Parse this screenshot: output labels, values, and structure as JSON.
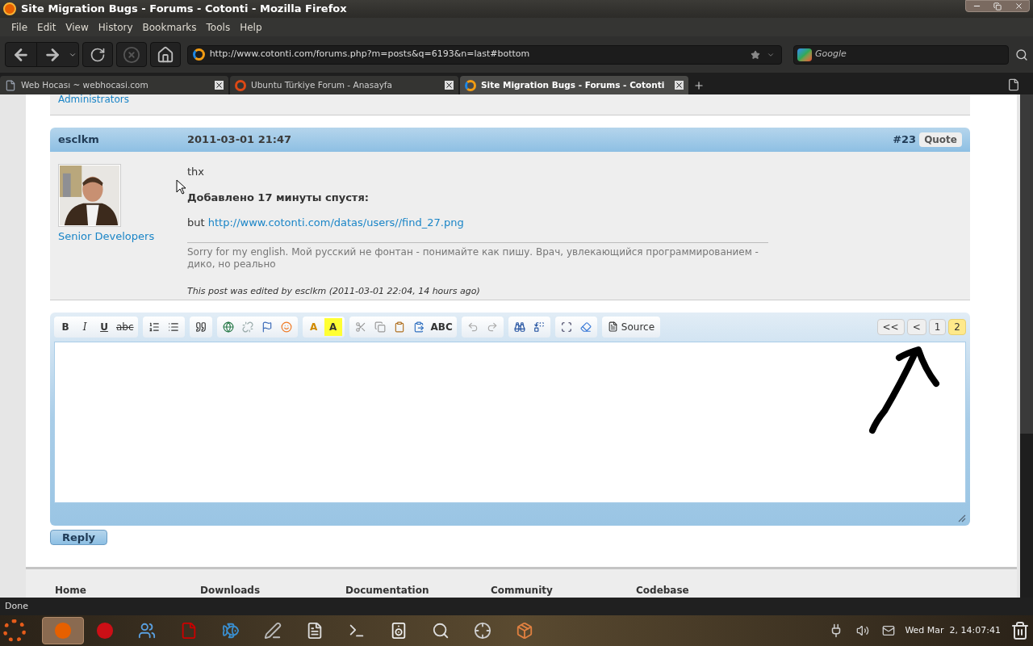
{
  "window": {
    "title": "Site Migration Bugs - Forums - Cotonti - Mozilla Firefox"
  },
  "menu": [
    "File",
    "Edit",
    "View",
    "History",
    "Bookmarks",
    "Tools",
    "Help"
  ],
  "address_bar": {
    "value": "http://www.cotonti.com/forums.php?m=posts&q=6193&n=last#bottom"
  },
  "search_bar": {
    "placeholder": "Google"
  },
  "tabs": [
    {
      "label": "Web Hocası ~ webhocasi.com",
      "kind": "page",
      "selected": false
    },
    {
      "label": "Ubuntu Türkiye Forum - Anasayfa",
      "kind": "ubuntu",
      "selected": false
    },
    {
      "label": "Site Migration Bugs - Forums - Cotonti",
      "kind": "cotonti",
      "selected": true
    }
  ],
  "previous_post": {
    "group": "Administrators"
  },
  "post": {
    "author": "esclkm",
    "date": "2011-03-01 21:47",
    "number": "#23",
    "quote": "Quote",
    "group": "Senior Developers",
    "lines": [
      {
        "kind": "plain",
        "text": "thx"
      },
      {
        "kind": "bold",
        "text": "Добавлено 17 минуты спустя:"
      },
      {
        "kind": "link",
        "text": "but ",
        "link": "http://www.cotonti.com/datas/users//find_27.png"
      }
    ],
    "signature": "Sorry for my english. Мой русский не фонтан - понимайте как пишу. Врач, увлекающийся программированием - дико, но реально",
    "edited": "This post was edited by esclkm (2011-03-01 22:04, 14 hours ago)"
  },
  "editor": {
    "toolbar": [
      [
        {
          "kind": "bold",
          "label": "B"
        },
        {
          "kind": "italic",
          "label": "I"
        },
        {
          "kind": "underline",
          "label": "U"
        },
        {
          "kind": "strike",
          "label": "abc"
        }
      ],
      [
        {
          "kind": "numbered"
        },
        {
          "kind": "bulleted"
        }
      ],
      [
        {
          "kind": "quote"
        }
      ],
      [
        {
          "kind": "link"
        },
        {
          "kind": "unlink"
        },
        {
          "kind": "anchor"
        },
        {
          "kind": "smiley"
        }
      ],
      [
        {
          "kind": "textcolor",
          "label": "A"
        },
        {
          "kind": "bgcolor",
          "label": "A"
        }
      ],
      [
        {
          "kind": "cut"
        },
        {
          "kind": "copy"
        },
        {
          "kind": "paste"
        },
        {
          "kind": "pasteword"
        },
        {
          "kind": "spell",
          "label": "ABC"
        }
      ],
      [
        {
          "kind": "undo"
        },
        {
          "kind": "redo"
        }
      ],
      [
        {
          "kind": "find"
        },
        {
          "kind": "replace"
        }
      ],
      [
        {
          "kind": "selectall"
        },
        {
          "kind": "eraser"
        }
      ],
      [
        {
          "kind": "source",
          "label": "Source"
        }
      ]
    ],
    "pages": [
      {
        "label": "<<",
        "selected": false
      },
      {
        "label": "<",
        "selected": false
      },
      {
        "label": "1",
        "selected": false
      },
      {
        "label": "2",
        "selected": true
      }
    ]
  },
  "reply_button": "Reply",
  "footer": [
    "Home",
    "Downloads",
    "Documentation",
    "Community",
    "Codebase"
  ],
  "status_bar": "Done",
  "taskbar": {
    "launchers": [
      {
        "kind": "firefox",
        "selected": true
      },
      {
        "kind": "opera",
        "selected": false
      },
      {
        "kind": "chat",
        "selected": false
      },
      {
        "kind": "filezilla",
        "selected": false
      },
      {
        "kind": "fish",
        "selected": false
      },
      {
        "kind": "gimp",
        "selected": false
      },
      {
        "kind": "editor",
        "selected": false
      },
      {
        "kind": "terminal",
        "selected": false
      },
      {
        "kind": "speaker",
        "selected": false
      },
      {
        "kind": "search",
        "selected": false
      },
      {
        "kind": "game",
        "selected": false
      },
      {
        "kind": "home",
        "selected": false
      }
    ],
    "clock": "Wed Mar  2, 14:07:41"
  }
}
